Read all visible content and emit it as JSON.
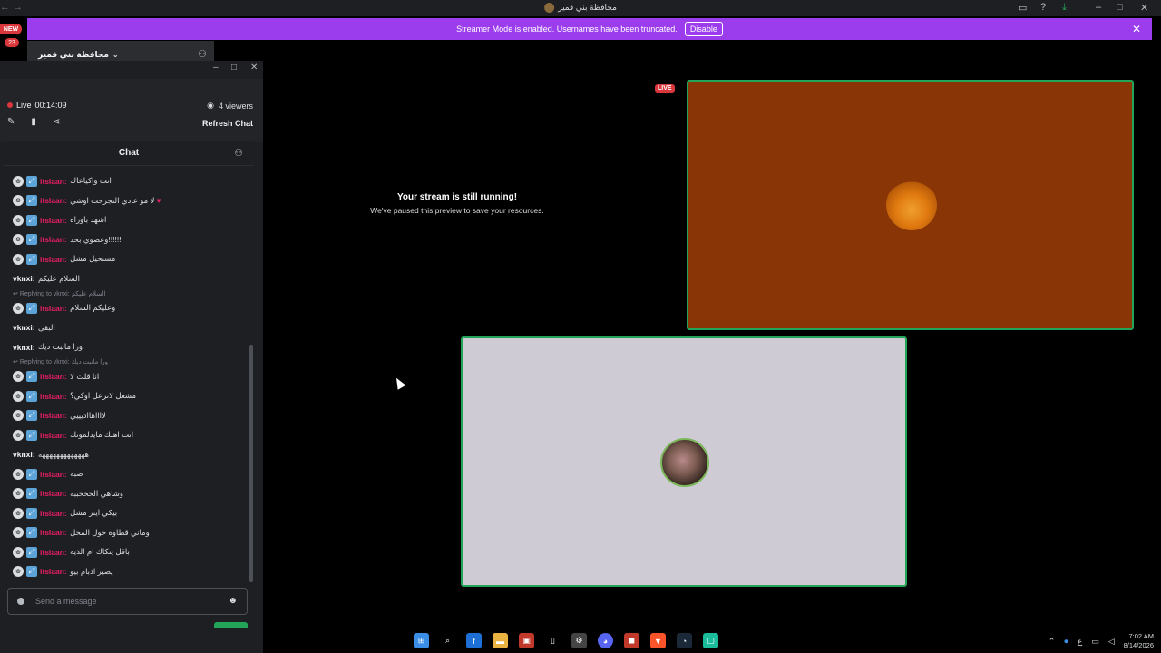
{
  "titlebar": {
    "title": "محافظة بني قمير",
    "nav_arrows": "← →"
  },
  "banner": {
    "message": "Streamer Mode is enabled. Usernames have been truncated.",
    "disable_label": "Disable",
    "close": "✕"
  },
  "rail": {
    "new_label": "NEW",
    "count": "23"
  },
  "server": {
    "name": "محافظة بني قمير"
  },
  "popout": {
    "live_label": "Live",
    "live_time": "00:14:09",
    "viewers": "4 viewers",
    "refresh_label": "Refresh Chat",
    "chat_title": "Chat",
    "input_placeholder": "Send a message"
  },
  "messages": [
    {
      "type": "user",
      "name": "itslaan:",
      "text": "انت واكياعاك"
    },
    {
      "type": "user",
      "name": "itslaan:",
      "text": "لا مو عادي النجرحت اوشي",
      "heart": true
    },
    {
      "type": "user",
      "name": "itslaan:",
      "text": "اشهد باوراه"
    },
    {
      "type": "user",
      "name": "itslaan:",
      "text": "وعضوي بحد!!!!!!"
    },
    {
      "type": "user",
      "name": "itslaan:",
      "text": "مستحيل مشل"
    },
    {
      "type": "plain",
      "name": "vknxi:",
      "text": "السلام عليكم"
    },
    {
      "type": "reply",
      "text": "Replying to vknxi: السلام عليكم"
    },
    {
      "type": "user",
      "name": "itslaan:",
      "text": "وعليكم السلام"
    },
    {
      "type": "plain",
      "name": "vknxi:",
      "text": "البقى"
    },
    {
      "type": "plain",
      "name": "vknxi:",
      "text": "ورا مانبت ديك"
    },
    {
      "type": "reply",
      "text": "Replying to vknxi: ورا مانبت ديك"
    },
    {
      "type": "user",
      "name": "itslaan:",
      "text": "انا قلت لا"
    },
    {
      "type": "user",
      "name": "itslaan:",
      "text": "مشعل لاتزعل اوكي؟"
    },
    {
      "type": "user",
      "name": "itslaan:",
      "text": "لااااهااديييي"
    },
    {
      "type": "user",
      "name": "itslaan:",
      "text": "انت اهلك مايدلمونك"
    },
    {
      "type": "plain",
      "name": "vknxi:",
      "text": "هههههههههههههه"
    },
    {
      "type": "user",
      "name": "itslaan:",
      "text": "صبه"
    },
    {
      "type": "user",
      "name": "itslaan:",
      "text": "وشاهي الخخخببه"
    },
    {
      "type": "user",
      "name": "itslaan:",
      "text": "بيكي ايتر مشل"
    },
    {
      "type": "user",
      "name": "itslaan:",
      "text": "وماني قطاوه حول المحل"
    },
    {
      "type": "user",
      "name": "itslaan:",
      "text": "باقل ينكاك ام الذيه"
    },
    {
      "type": "user",
      "name": "itslaan:",
      "text": "يصير ادبام بيو"
    }
  ],
  "stream": {
    "paused_title": "Your stream is still running!",
    "paused_sub": "We've paused this preview to save your resources.",
    "live_tag": "LIVE"
  },
  "taskbar": {
    "lang": "ع",
    "time": "7:02 AM",
    "date": "8/14/2026"
  },
  "colors": {
    "accent": "#9b3ded",
    "username": "#e91e63",
    "live": "#da373c",
    "speaking": "#23a559",
    "tile1": "#8a3506",
    "tile2": "#cfcbd5"
  }
}
